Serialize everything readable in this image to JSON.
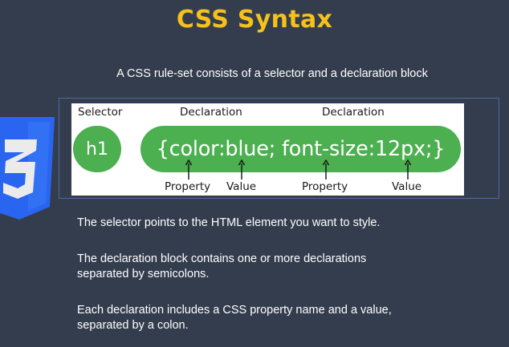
{
  "slide": {
    "title": "CSS Syntax",
    "subtitle": "A CSS rule-set consists of a selector and a declaration block"
  },
  "diagram": {
    "selector_label": "Selector",
    "declaration_label_1": "Declaration",
    "declaration_label_2": "Declaration",
    "selector_code": "h1",
    "declaration_code": "{color:blue; font-size:12px;}",
    "property_label_1": "Property",
    "value_label_1": "Value",
    "property_label_2": "Property",
    "value_label_2": "Value",
    "pill_color": "#4caf50"
  },
  "logo": {
    "icon": "css3-shield-icon",
    "color": "#2965f1"
  },
  "paragraphs": {
    "p1": "The selector points to the HTML element you want to style.",
    "p2_line1": "The declaration block contains one or more declarations",
    "p2_line2": "separated by semicolons.",
    "p3_line1": "Each declaration includes a CSS property name and a value,",
    "p3_line2": "separated by a colon."
  },
  "colors": {
    "background": "#343d4e",
    "title": "#f5c11a",
    "text": "#ffffff"
  }
}
